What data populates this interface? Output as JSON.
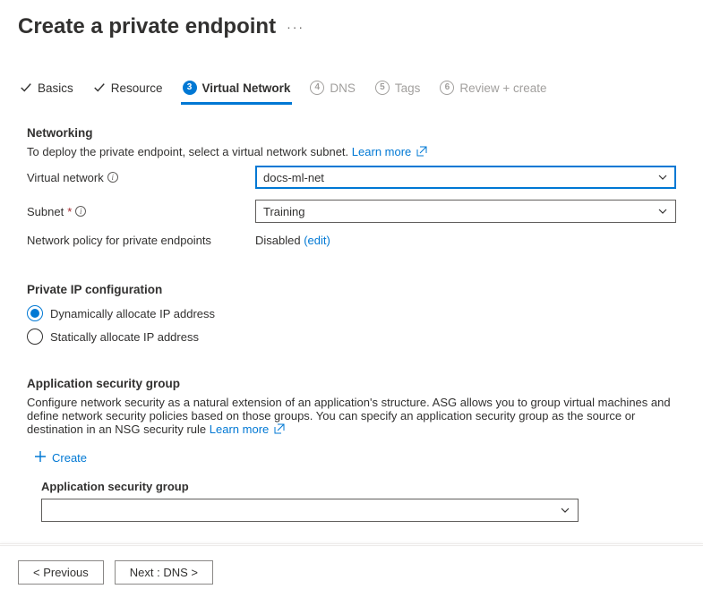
{
  "header": {
    "title": "Create a private endpoint"
  },
  "tabs": {
    "basics": "Basics",
    "resource": "Resource",
    "virtual_network_num": "3",
    "virtual_network": "Virtual Network",
    "dns_num": "4",
    "dns": "DNS",
    "tags_num": "5",
    "tags": "Tags",
    "review_num": "6",
    "review": "Review + create"
  },
  "networking": {
    "title": "Networking",
    "desc": "To deploy the private endpoint, select a virtual network subnet.",
    "learn_more": "Learn more",
    "vnet_label": "Virtual network",
    "vnet_value": "docs-ml-net",
    "subnet_label": "Subnet",
    "subnet_value": "Training",
    "policy_label": "Network policy for private endpoints",
    "policy_value": "Disabled",
    "policy_edit": "(edit)"
  },
  "ipconfig": {
    "title": "Private IP configuration",
    "dynamic": "Dynamically allocate IP address",
    "static": "Statically allocate IP address"
  },
  "asg": {
    "title": "Application security group",
    "desc": "Configure network security as a natural extension of an application's structure. ASG allows you to group virtual machines and define network security policies based on those groups. You can specify an application security group as the source or destination in an NSG security rule",
    "learn_more": "Learn more",
    "create": "Create",
    "sub_label": "Application security group"
  },
  "footer": {
    "prev": "< Previous",
    "next": "Next : DNS >"
  }
}
